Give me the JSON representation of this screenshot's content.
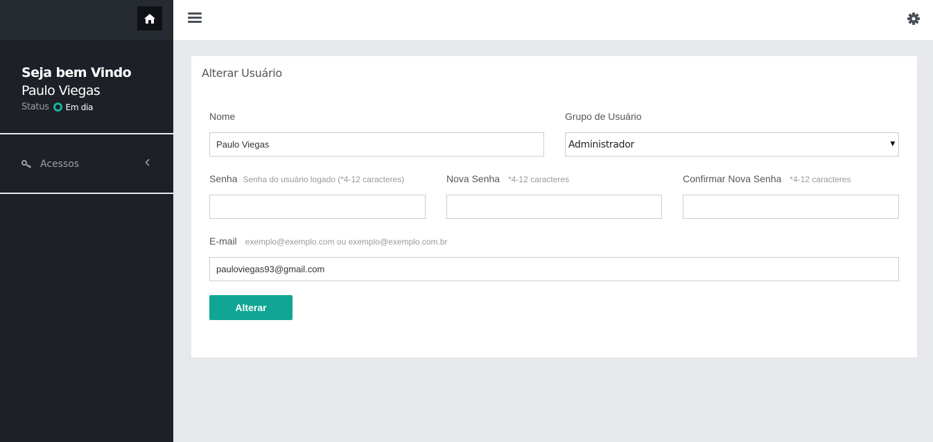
{
  "sidebar": {
    "welcome_title": "Seja bem Vindo",
    "user_name": "Paulo Viegas",
    "status_label": "Status",
    "status_value": "Em dia",
    "status_color": "#19b39d",
    "menu": [
      {
        "label": "Acessos",
        "icon": "key-icon"
      }
    ]
  },
  "form": {
    "title": "Alterar Usuário",
    "nome": {
      "label": "Nome",
      "value": "Paulo Viegas"
    },
    "grupo": {
      "label": "Grupo de Usuário",
      "selected": "Administrador"
    },
    "senha": {
      "label": "Senha",
      "hint": "Senha do usuário logado (*4-12 caracteres)",
      "value": ""
    },
    "nova_senha": {
      "label": "Nova Senha",
      "hint": "*4-12 caracteres",
      "value": ""
    },
    "confirmar_senha": {
      "label": "Confirmar Nova Senha",
      "hint": "*4-12 caracteres",
      "value": ""
    },
    "email": {
      "label": "E-mail",
      "hint": "exemplo@exemplo.com ou exemplo@exemplo.com.br",
      "value": "pauloviegas93@gmail.com"
    },
    "submit_label": "Alterar",
    "accent_color": "#10a693"
  }
}
